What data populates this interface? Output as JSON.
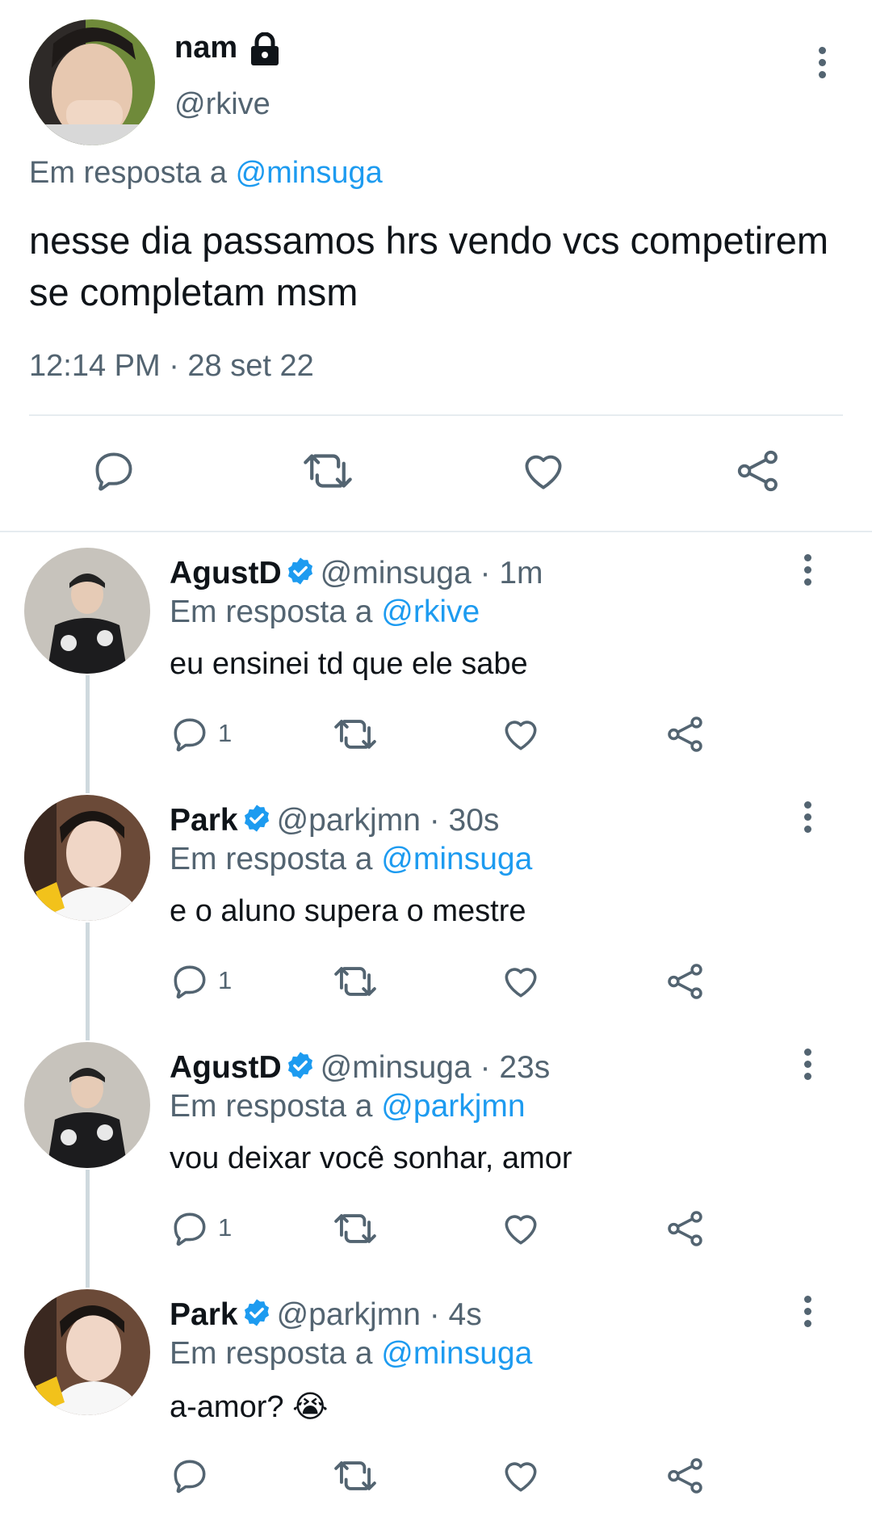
{
  "main_tweet": {
    "name": "nam",
    "handle": "@rkive",
    "reply_prefix": "Em resposta a",
    "reply_to": "@minsuga",
    "text": "nesse dia passamos hrs vendo vcs competirem se completam msm",
    "timestamp": "12:14 PM · 28 set 22",
    "locked_icon": "lock-icon"
  },
  "replies": [
    {
      "name": "AgustD",
      "handle": "@minsuga",
      "time": "· 1m",
      "reply_prefix": "Em resposta a",
      "reply_to": "@rkive",
      "text": "eu ensinei td que ele sabe",
      "reply_count": "1",
      "verified": true
    },
    {
      "name": "Park",
      "handle": "@parkjmn",
      "time": "· 30s",
      "reply_prefix": "Em resposta a",
      "reply_to": "@minsuga",
      "text": "e o aluno supera o mestre",
      "reply_count": "1",
      "verified": true
    },
    {
      "name": "AgustD",
      "handle": "@minsuga",
      "time": "· 23s",
      "reply_prefix": "Em resposta a",
      "reply_to": "@parkjmn",
      "text": "vou deixar você sonhar, amor",
      "reply_count": "1",
      "verified": true
    },
    {
      "name": "Park",
      "handle": "@parkjmn",
      "time": "· 4s",
      "reply_prefix": "Em resposta a",
      "reply_to": "@minsuga",
      "text": "a-amor? 😭",
      "reply_count": "",
      "verified": true
    }
  ],
  "colors": {
    "accent": "#1d9bf0",
    "muted": "#536471",
    "divider": "#e6ecf0"
  }
}
